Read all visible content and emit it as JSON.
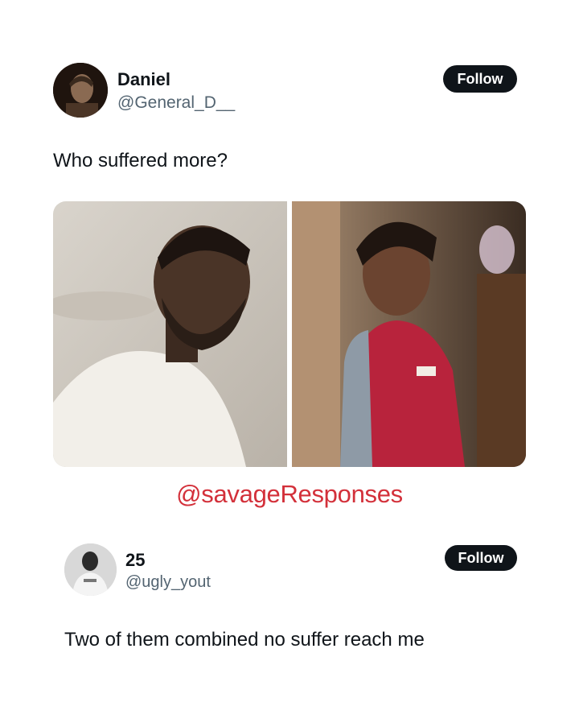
{
  "post": {
    "author_name": "Daniel",
    "author_handle": "@General_D__",
    "follow_label": "Follow",
    "text": "Who suffered more?"
  },
  "watermark": "@savageResponses",
  "reply": {
    "author_name": "25",
    "author_handle": "@ugly_yout",
    "follow_label": "Follow",
    "text": "Two of them combined no suffer reach me"
  },
  "colors": {
    "follow_button": "#0f1419",
    "handle_gray": "#536471",
    "watermark_red": "#d3303a"
  }
}
